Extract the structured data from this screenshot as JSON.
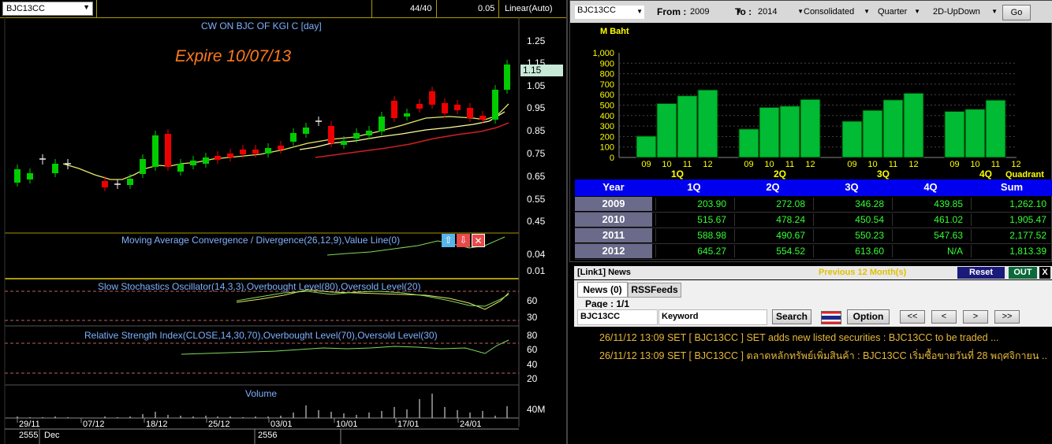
{
  "left_toolbar": {
    "symbol": "BJC13CC",
    "ratio": "44/40",
    "step": "0.05",
    "scale": "Linear(Auto)"
  },
  "main_chart": {
    "title": "CW ON BJC OF KGI   C [day]",
    "expire_note": "Expire 10/07/13",
    "last_price_tag": "1.15",
    "price_ticks": [
      "1.25",
      "1.15",
      "1.05",
      "0.95",
      "0.85",
      "0.75",
      "0.65",
      "0.55",
      "0.45"
    ],
    "macd_title": "Moving Average Convergence / Divergence(26,12,9),Value Line(0)",
    "macd_ticks": [
      "0.04",
      "0.01"
    ],
    "sto_title": "Slow Stochastics Oscillator(14,3,3),Overbought Level(80),Oversold Level(20)",
    "sto_ticks": [
      "60",
      "30"
    ],
    "rsi_title": "Relative Strength Index(CLOSE,14,30,70),Overbought Level(70),Oversold Level(30)",
    "rsi_ticks": [
      "80",
      "60",
      "40",
      "20"
    ],
    "volume_title": "Volume",
    "volume_tick": "40M",
    "date_ticks": [
      "29/11",
      "07/12",
      "18/12",
      "25/12",
      "03/01",
      "10/01",
      "17/01",
      "24/01"
    ],
    "year_labels": [
      "2555",
      "Dec",
      "2556"
    ]
  },
  "chart_data": [
    {
      "type": "bar",
      "title": "",
      "ylabel": "M Baht",
      "xlabel": "Quadrant",
      "ylim": [
        0,
        1000
      ],
      "y_ticks": [
        "1,000",
        "900",
        "800",
        "700",
        "600",
        "500",
        "400",
        "300",
        "200",
        "100",
        "0"
      ],
      "groups": [
        "1Q",
        "2Q",
        "3Q",
        "4Q"
      ],
      "categories": [
        "09",
        "10",
        "11",
        "12"
      ],
      "series": [
        {
          "group": "1Q",
          "values": [
            203.9,
            515.67,
            588.98,
            645.27
          ]
        },
        {
          "group": "2Q",
          "values": [
            272.08,
            478.24,
            490.67,
            554.52
          ]
        },
        {
          "group": "3Q",
          "values": [
            346.28,
            450.54,
            550.23,
            613.6
          ]
        },
        {
          "group": "4Q",
          "values": [
            439.85,
            461.02,
            547.63,
            null
          ]
        }
      ]
    }
  ],
  "right_toolbar": {
    "symbol": "BJC13CC",
    "from_label": "From :",
    "from_value": "2009",
    "to_label": "To :",
    "to_value": "2014",
    "type_value": "Consolidated",
    "period_value": "Quarter",
    "view_value": "2D-UpDown",
    "go_label": "Go"
  },
  "table": {
    "headers": [
      "Year",
      "1Q",
      "2Q",
      "3Q",
      "4Q",
      "Sum"
    ],
    "rows": [
      {
        "year": "2009",
        "q1": "203.90",
        "q2": "272.08",
        "q3": "346.28",
        "q4": "439.85",
        "sum": "1,262.10"
      },
      {
        "year": "2010",
        "q1": "515.67",
        "q2": "478.24",
        "q3": "450.54",
        "q4": "461.02",
        "sum": "1,905.47"
      },
      {
        "year": "2011",
        "q1": "588.98",
        "q2": "490.67",
        "q3": "550.23",
        "q4": "547.63",
        "sum": "2,177.52"
      },
      {
        "year": "2012",
        "q1": "645.27",
        "q2": "554.52",
        "q3": "613.60",
        "q4": "N/A",
        "sum": "1,813.39"
      }
    ]
  },
  "news": {
    "header": "[Link1] News",
    "previous": "Previous 12 Month(s)",
    "reset": "Reset",
    "out": "OUT",
    "close": "X",
    "tab_news": "News (0)",
    "tab_rss": "RSSFeeds",
    "page": "Page : 1/1",
    "symbol": "BJC13CC",
    "keyword_label": "Keyword",
    "search": "Search",
    "option": "Option",
    "nav": [
      "<<",
      "<",
      ">",
      ">>"
    ],
    "items": [
      "26/11/12 13:09  SET  [ BJC13CC ]  SET adds new listed securities : BJC13CC to be traded ...",
      "26/11/12 13:09  SET  [ BJC13CC ]  ตลาดหลักทรัพย์เพิ่มสินค้า : BJC13CC เริ่มซื้อขายวันที่ 28 พฤศจิกายน ..."
    ]
  }
}
